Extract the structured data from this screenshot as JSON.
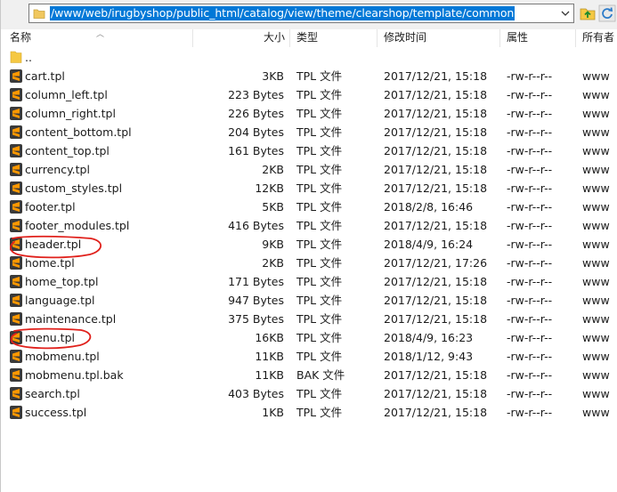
{
  "pathbar": {
    "path": "/www/web/irugbyshop/public_html/catalog/view/theme/clearshop/template/common"
  },
  "columns": {
    "name": "名称",
    "size": "大小",
    "type": "类型",
    "mtime": "修改时间",
    "perm": "属性",
    "owner": "所有者"
  },
  "parent_row": {
    "name": ".."
  },
  "files": [
    {
      "name": "cart.tpl",
      "size": "3KB",
      "type": "TPL 文件",
      "mtime": "2017/12/21, 15:18",
      "perm": "-rw-r--r--",
      "owner": "www"
    },
    {
      "name": "column_left.tpl",
      "size": "223 Bytes",
      "type": "TPL 文件",
      "mtime": "2017/12/21, 15:18",
      "perm": "-rw-r--r--",
      "owner": "www"
    },
    {
      "name": "column_right.tpl",
      "size": "226 Bytes",
      "type": "TPL 文件",
      "mtime": "2017/12/21, 15:18",
      "perm": "-rw-r--r--",
      "owner": "www"
    },
    {
      "name": "content_bottom.tpl",
      "size": "204 Bytes",
      "type": "TPL 文件",
      "mtime": "2017/12/21, 15:18",
      "perm": "-rw-r--r--",
      "owner": "www"
    },
    {
      "name": "content_top.tpl",
      "size": "161 Bytes",
      "type": "TPL 文件",
      "mtime": "2017/12/21, 15:18",
      "perm": "-rw-r--r--",
      "owner": "www"
    },
    {
      "name": "currency.tpl",
      "size": "2KB",
      "type": "TPL 文件",
      "mtime": "2017/12/21, 15:18",
      "perm": "-rw-r--r--",
      "owner": "www"
    },
    {
      "name": "custom_styles.tpl",
      "size": "12KB",
      "type": "TPL 文件",
      "mtime": "2017/12/21, 15:18",
      "perm": "-rw-r--r--",
      "owner": "www"
    },
    {
      "name": "footer.tpl",
      "size": "5KB",
      "type": "TPL 文件",
      "mtime": "2018/2/8, 16:46",
      "perm": "-rw-r--r--",
      "owner": "www"
    },
    {
      "name": "footer_modules.tpl",
      "size": "416 Bytes",
      "type": "TPL 文件",
      "mtime": "2017/12/21, 15:18",
      "perm": "-rw-r--r--",
      "owner": "www"
    },
    {
      "name": "header.tpl",
      "size": "9KB",
      "type": "TPL 文件",
      "mtime": "2018/4/9, 16:24",
      "perm": "-rw-r--r--",
      "owner": "www"
    },
    {
      "name": "home.tpl",
      "size": "2KB",
      "type": "TPL 文件",
      "mtime": "2017/12/21, 17:26",
      "perm": "-rw-r--r--",
      "owner": "www"
    },
    {
      "name": "home_top.tpl",
      "size": "171 Bytes",
      "type": "TPL 文件",
      "mtime": "2017/12/21, 15:18",
      "perm": "-rw-r--r--",
      "owner": "www"
    },
    {
      "name": "language.tpl",
      "size": "947 Bytes",
      "type": "TPL 文件",
      "mtime": "2017/12/21, 15:18",
      "perm": "-rw-r--r--",
      "owner": "www"
    },
    {
      "name": "maintenance.tpl",
      "size": "375 Bytes",
      "type": "TPL 文件",
      "mtime": "2017/12/21, 15:18",
      "perm": "-rw-r--r--",
      "owner": "www"
    },
    {
      "name": "menu.tpl",
      "size": "16KB",
      "type": "TPL 文件",
      "mtime": "2018/4/9, 16:23",
      "perm": "-rw-r--r--",
      "owner": "www"
    },
    {
      "name": "mobmenu.tpl",
      "size": "11KB",
      "type": "TPL 文件",
      "mtime": "2018/1/12, 9:43",
      "perm": "-rw-r--r--",
      "owner": "www"
    },
    {
      "name": "mobmenu.tpl.bak",
      "size": "11KB",
      "type": "BAK 文件",
      "mtime": "2017/12/21, 15:18",
      "perm": "-rw-r--r--",
      "owner": "www"
    },
    {
      "name": "search.tpl",
      "size": "403 Bytes",
      "type": "TPL 文件",
      "mtime": "2017/12/21, 15:18",
      "perm": "-rw-r--r--",
      "owner": "www"
    },
    {
      "name": "success.tpl",
      "size": "1KB",
      "type": "TPL 文件",
      "mtime": "2017/12/21, 15:18",
      "perm": "-rw-r--r--",
      "owner": "www"
    }
  ],
  "icons": {
    "file": "sublime-text-file-icon",
    "folder": "folder-icon",
    "parent": "parent-directory-icon",
    "refresh": "refresh-icon",
    "dropdown": "chevron-down-icon"
  },
  "colors": {
    "selection": "#0078d7",
    "annotation": "#e0201b",
    "file_icon_bg": "#3a3a3a",
    "file_icon_accent": "#ff9800",
    "folder": "#f5c842"
  }
}
